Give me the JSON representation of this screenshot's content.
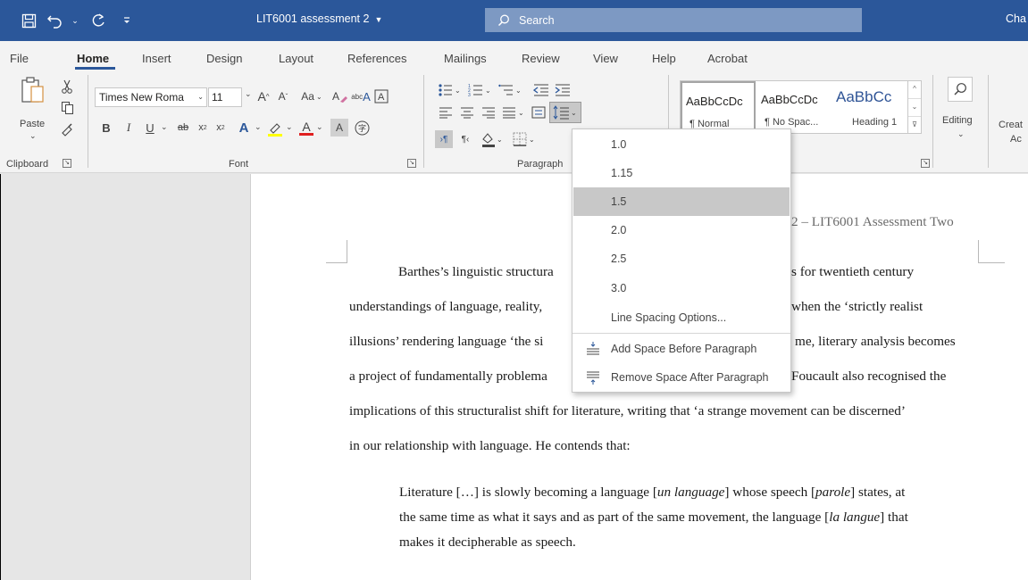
{
  "titlebar": {
    "doc_title": "LIT6001 assessment 2",
    "search_label": "Search",
    "user_partial": "Cha"
  },
  "tabs": [
    "File",
    "Home",
    "Insert",
    "Design",
    "Layout",
    "References",
    "Mailings",
    "Review",
    "View",
    "Help",
    "Acrobat"
  ],
  "ribbon": {
    "clipboard": {
      "paste_label": "Paste",
      "group_label": "Clipboard"
    },
    "font": {
      "font_name": "Times New Roma",
      "font_size": "11",
      "group_label": "Font",
      "change_case": "Aa",
      "bold": "B",
      "italic": "I",
      "underline": "U",
      "grow": "A",
      "shrink": "A"
    },
    "paragraph": {
      "group_label": "Paragraph"
    },
    "styles": {
      "group_label": "Styles",
      "visible_label_partial": "les",
      "items": [
        {
          "sample": "AaBbCcDc",
          "name": "¶ Normal"
        },
        {
          "sample": "AaBbCcDc",
          "name": "¶ No Spac..."
        },
        {
          "sample": "AaBbCc",
          "name": "Heading 1"
        }
      ]
    },
    "editing": {
      "label": "Editing"
    },
    "create_partial": {
      "line1": "Creat",
      "line2": "Ac"
    }
  },
  "line_spacing_menu": {
    "options": [
      "1.0",
      "1.15",
      "1.5",
      "2.0",
      "2.5",
      "3.0"
    ],
    "selected": "1.5",
    "options_link": "Line Spacing Options...",
    "add_space_before": "Add Space Before Paragraph",
    "remove_space_after": "Remove Space After Paragraph"
  },
  "document": {
    "header_partial": "2 – LIT6001 Assessment Two",
    "lines_left": [
      "Barthes’s linguistic structura",
      "understandings of language, reality,",
      "illusions’ rendering language ‘the si",
      "a project of fundamentally problema"
    ],
    "lines_right": [
      "s for twentieth century",
      "when the ‘strictly realist",
      "me, literary analysis becomes",
      "Foucault also recognised the"
    ],
    "line5": "implications of this structuralist shift for literature, writing that ‘a strange movement can be discerned’",
    "line6": "in our relationship with language. He contends that:",
    "quote": {
      "l1_a": "Literature […] is slowly becoming a language [",
      "l1_b": "un language",
      "l1_c": "] whose speech [",
      "l1_d": "parole",
      "l1_e": "] states, at",
      "l2_a": "the same time as what it says and as part of the same movement, the language [",
      "l2_b": "la langue",
      "l2_c": "] that",
      "l3": "makes it decipherable as speech."
    }
  },
  "colors": {
    "titlebar": "#2b579a",
    "search_box": "#7d99c3",
    "ribbon_bg": "#f3f3f3",
    "menu_selected": "#c8c8c8"
  }
}
